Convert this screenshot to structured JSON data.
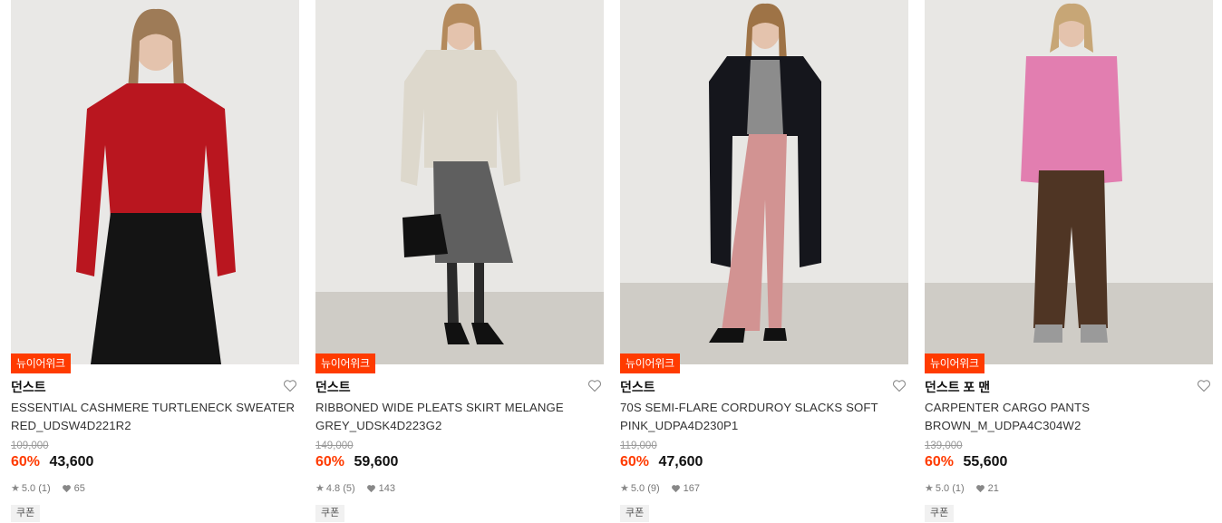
{
  "products": [
    {
      "badge": "뉴이어위크",
      "brand": "던스트",
      "name": "ESSENTIAL CASHMERE TURTLENECK SWEATER RED_UDSW4D221R2",
      "original_price": "109,000",
      "discount": "60%",
      "price": "43,600",
      "rating": "5.0 (1)",
      "likes": "65",
      "coupon": "쿠폰",
      "colors": {
        "top": "#b9161f",
        "bottom": "#141414",
        "bg": "#e9e8e6",
        "floor": "#e9e8e6"
      }
    },
    {
      "badge": "뉴이어위크",
      "brand": "던스트",
      "name": "RIBBONED WIDE PLEATS SKIRT MELANGE GREY_UDSK4D223G2",
      "original_price": "149,000",
      "discount": "60%",
      "price": "59,600",
      "rating": "4.8 (5)",
      "likes": "143",
      "coupon": "쿠폰",
      "colors": {
        "top": "#ddd8cc",
        "bottom": "#5f5f5f",
        "bg": "#e8e7e4",
        "floor": "#cfccc6"
      }
    },
    {
      "badge": "뉴이어위크",
      "brand": "던스트",
      "name": "70S SEMI-FLARE CORDUROY SLACKS SOFT PINK_UDPA4D230P1",
      "original_price": "119,000",
      "discount": "60%",
      "price": "47,600",
      "rating": "5.0 (9)",
      "likes": "167",
      "coupon": "쿠폰",
      "colors": {
        "top": "#15161c",
        "bottom": "#d29392",
        "bg": "#e8e7e4",
        "floor": "#cfccc6"
      }
    },
    {
      "badge": "뉴이어위크",
      "brand": "던스트 포 맨",
      "name": "CARPENTER CARGO PANTS BROWN_M_UDPA4C304W2",
      "original_price": "139,000",
      "discount": "60%",
      "price": "55,600",
      "rating": "5.0 (1)",
      "likes": "21",
      "coupon": "쿠폰",
      "colors": {
        "top": "#e27eb0",
        "bottom": "#4f3524",
        "bg": "#e8e7e4",
        "floor": "#cfccc6"
      }
    }
  ],
  "icons": {
    "wishlist": "heart-outline-icon",
    "rating": "star-icon",
    "likes": "heart-filled-icon"
  }
}
